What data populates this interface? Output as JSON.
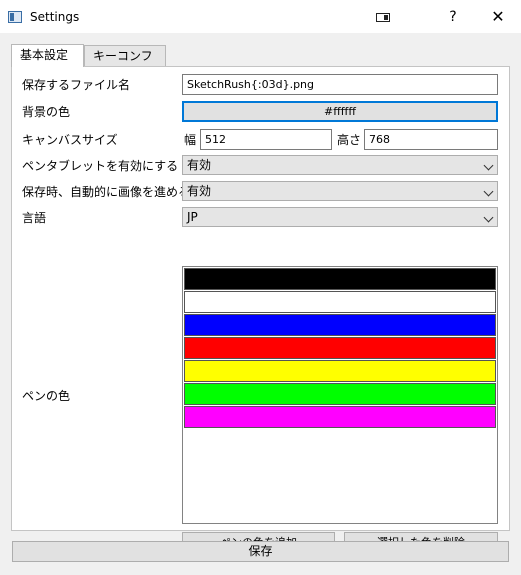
{
  "window": {
    "title": "Settings",
    "help_label": "?",
    "close_label": "✕"
  },
  "tabs": [
    {
      "label": "基本設定",
      "active": true
    },
    {
      "label": "キーコンフィグ",
      "active": false
    }
  ],
  "form": {
    "filename_label": "保存するファイル名",
    "filename_value": "SketchRush{:03d}.png",
    "bg_color_label": "背景の色",
    "bg_color_value": "#ffffff",
    "canvas_size_label": "キャンバスサイズ",
    "width_label": "幅",
    "width_value": "512",
    "height_label": "高さ",
    "height_value": "768",
    "pentablet_label": "ペンタブレットを有効にする",
    "pentablet_value": "有効",
    "autoadvance_label": "保存時、自動的に画像を進める",
    "autoadvance_value": "有効",
    "language_label": "言語",
    "language_value": "JP",
    "pen_color_label": "ペンの色",
    "pen_colors": [
      "#000000",
      "#ffffff",
      "#0000ff",
      "#ff0000",
      "#ffff00",
      "#00ff00",
      "#ff00ff"
    ],
    "add_color_label": "ペンの色を追加",
    "remove_color_label": "選択した色を削除"
  },
  "footer": {
    "save_label": "保存"
  }
}
